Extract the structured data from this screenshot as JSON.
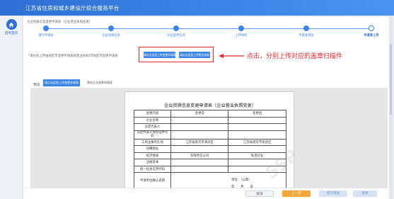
{
  "app": {
    "title": "江苏省住房和城乡建设厅综合服务平台"
  },
  "sidebar": {
    "home_label": "回到首页"
  },
  "breadcrumb": "企业资质信息变更申请表（企业营业执照变更）",
  "steps": [
    {
      "label": "填写申请表",
      "state": "done"
    },
    {
      "label": "企业资质信息",
      "state": "done"
    },
    {
      "label": "企业变更信息",
      "state": "done"
    },
    {
      "label": "上传材料",
      "state": "done"
    },
    {
      "label": "申请表预览",
      "state": "done"
    },
    {
      "label": "申请表上传",
      "state": "active"
    }
  ],
  "hint_text": "*请分别上传由地区市变更申请表和营业执照/市地区市变更申请表",
  "upload": {
    "btn_left": "请点击这里上传变更申请表",
    "btn_right": "请点击这里上传营业执照"
  },
  "annotation": "点击，分别上传对应的盖章扫描件",
  "preview": {
    "label": "预览",
    "tab_active": "请点击这里上传变更申请表",
    "tab_other": "预览企业变更申请表"
  },
  "document": {
    "title": "企业资质信息变更申请表（企业营业执照变更）",
    "header_row": [
      "变更内容",
      "变更前",
      "变更后"
    ],
    "rows": [
      [
        "企业名称",
        "",
        ""
      ],
      [
        "法定代表人",
        "",
        ""
      ],
      [
        "法定代表人身份证件号码",
        "",
        ""
      ],
      [
        "工商注册所在地",
        "江苏省南京市清凉区",
        "江苏省南京市金武区"
      ],
      [
        "详细地址",
        "",
        ""
      ],
      [
        "经济性质",
        "有限责任公司",
        "私营企业"
      ],
      [
        "注册资本",
        "",
        ""
      ],
      [
        "统一社会信用代码",
        "",
        ""
      ]
    ],
    "footer_label": "申请单位确认说明",
    "seal_text": "单位：（公章）",
    "date_text": "年　　月　　日",
    "watermark": "SSP"
  },
  "footer": {
    "btn_cancel": "取消",
    "btn_prev": "上一步",
    "btn_submit": "提交审核",
    "btn_save": "保存"
  },
  "colors": {
    "primary": "#3d86e8",
    "highlight": "#e5262c",
    "warning": "#f3a83a"
  }
}
